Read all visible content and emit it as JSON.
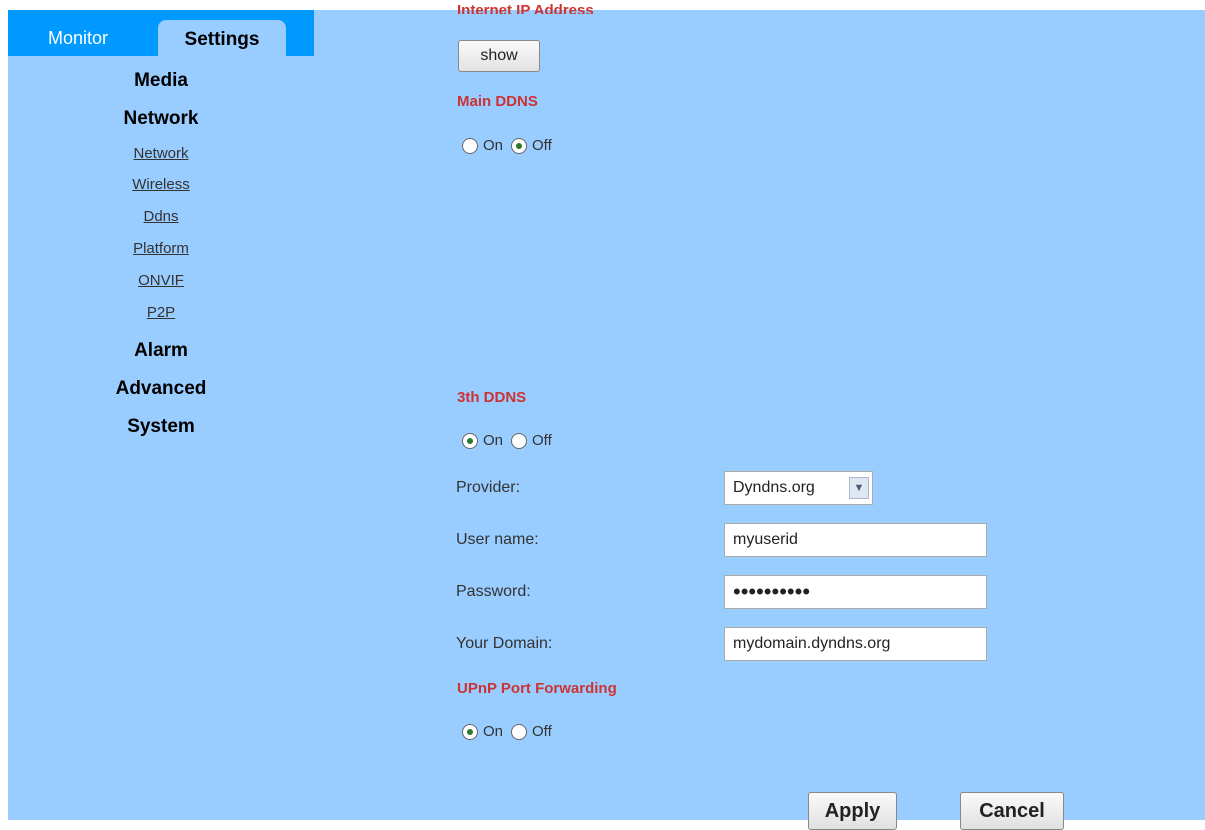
{
  "tabs": {
    "monitor": "Monitor",
    "settings": "Settings"
  },
  "nav": {
    "media": "Media",
    "network": "Network",
    "network_items": [
      "Network",
      "Wireless",
      "Ddns",
      "Platform",
      "ONVIF",
      "P2P"
    ],
    "alarm": "Alarm",
    "advanced": "Advanced",
    "system": "System"
  },
  "main": {
    "clipped_heading": "Internet IP Address",
    "show_button": "show",
    "main_ddns": {
      "title": "Main DDNS",
      "on_label": "On",
      "off_label": "Off",
      "selected": "Off"
    },
    "third_ddns": {
      "title": "3th DDNS",
      "on_label": "On",
      "off_label": "Off",
      "selected": "On",
      "provider_label": "Provider:",
      "provider_value": "Dyndns.org",
      "username_label": "User name:",
      "username_value": "myuserid",
      "password_label": "Password:",
      "password_value": "••••••••••",
      "domain_label": "Your Domain:",
      "domain_value": "mydomain.dyndns.org"
    },
    "upnp": {
      "title": "UPnP Port Forwarding",
      "on_label": "On",
      "off_label": "Off",
      "selected": "On"
    },
    "apply_button": "Apply",
    "cancel_button": "Cancel"
  },
  "colors": {
    "panel_bg": "#99ccff",
    "tabbar_bg": "#0099ff",
    "section_title": "#cc3333"
  }
}
